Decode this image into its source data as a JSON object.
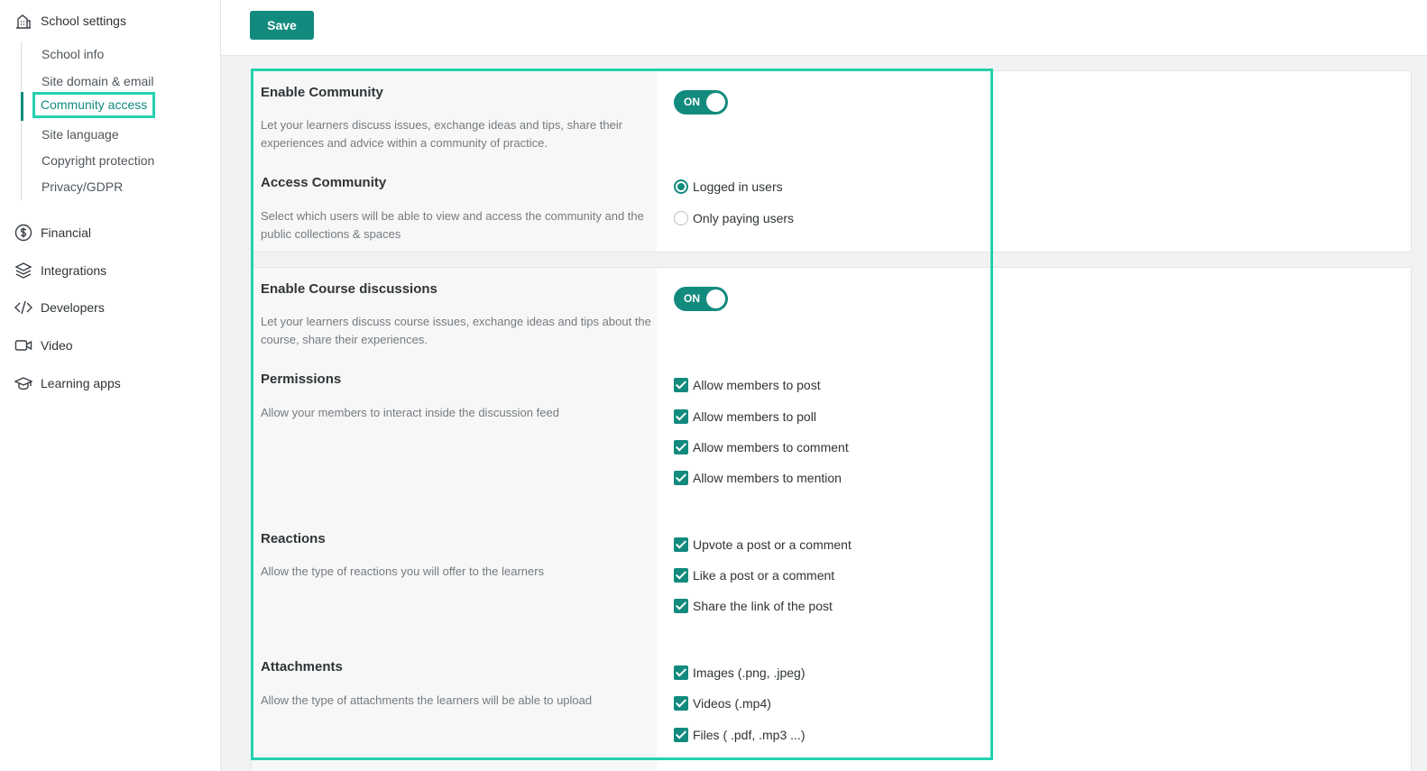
{
  "sidebar": {
    "school_settings": {
      "label": "School settings",
      "icon": "building-icon"
    },
    "subitems": [
      {
        "label": "School info"
      },
      {
        "label": "Site domain & email"
      },
      {
        "label": "Community access"
      },
      {
        "label": "Site language"
      },
      {
        "label": "Copyright protection"
      },
      {
        "label": "Privacy/GDPR"
      }
    ],
    "active_subitem": "Community access",
    "groups": [
      {
        "label": "Financial",
        "icon": "dollar-circle-icon"
      },
      {
        "label": "Integrations",
        "icon": "layers-icon"
      },
      {
        "label": "Developers",
        "icon": "code-icon"
      },
      {
        "label": "Video",
        "icon": "video-camera-icon"
      },
      {
        "label": "Learning apps",
        "icon": "graduation-cap-icon"
      }
    ]
  },
  "toolbar": {
    "save_label": "Save"
  },
  "community": {
    "enable": {
      "title": "Enable Community",
      "description": "Let your learners discuss issues, exchange ideas and tips, share their experiences and advice within a community of practice.",
      "toggle_label": "ON",
      "enabled": true
    },
    "access": {
      "title": "Access Community",
      "description": "Select which users will be able to view and access the community and the public collections & spaces",
      "options": [
        {
          "label": "Logged in users",
          "selected": true
        },
        {
          "label": "Only paying users",
          "selected": false
        }
      ]
    }
  },
  "course_discussions": {
    "enable": {
      "title": "Enable Course discussions",
      "description": "Let your learners discuss course issues, exchange ideas and tips about the course, share their experiences.",
      "toggle_label": "ON",
      "enabled": true
    },
    "permissions": {
      "title": "Permissions",
      "description": "Allow your members to interact inside the discussion feed",
      "options": [
        {
          "label": "Allow members to post",
          "checked": true
        },
        {
          "label": "Allow members to poll",
          "checked": true
        },
        {
          "label": "Allow members to comment",
          "checked": true
        },
        {
          "label": "Allow members to mention",
          "checked": true
        }
      ]
    },
    "reactions": {
      "title": "Reactions",
      "description": "Allow the type of reactions you will offer to the learners",
      "options": [
        {
          "label": "Upvote a post or a comment",
          "checked": true
        },
        {
          "label": "Like a post or a comment",
          "checked": true
        },
        {
          "label": "Share the link of the post",
          "checked": true
        }
      ]
    },
    "attachments": {
      "title": "Attachments",
      "description": "Allow the type of attachments the learners will be able to upload",
      "options": [
        {
          "label": "Images (.png, .jpeg)",
          "checked": true
        },
        {
          "label": "Videos (.mp4)",
          "checked": true
        },
        {
          "label": "Files ( .pdf, .mp3 ...)",
          "checked": true
        }
      ]
    }
  },
  "colors": {
    "accent": "#128a7e",
    "highlight": "#23d1ad"
  }
}
